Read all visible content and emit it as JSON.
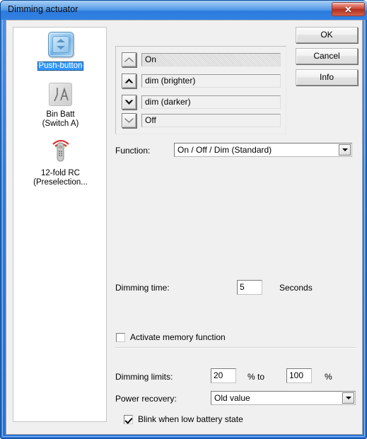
{
  "window": {
    "title": "Dimming actuator",
    "close_label": "✕",
    "accent_color": "#2f7ce0",
    "close_color": "#c33f2d"
  },
  "sidebar": {
    "items": [
      {
        "label": "Push-button",
        "icon": "push-button-icon",
        "selected": true
      },
      {
        "label": "Bin Batt\n(Switch A)",
        "icon": "switch-icon",
        "selected": false
      },
      {
        "label": "12-fold RC\n(Preselection...",
        "icon": "remote-control-icon",
        "selected": false
      }
    ]
  },
  "buttons": {
    "ok": "OK",
    "cancel": "Cancel",
    "info": "Info"
  },
  "rocker_group": {
    "rows": [
      {
        "icon": "chevron-up-thin-icon",
        "value": "On",
        "focused": true
      },
      {
        "icon": "chevron-up-bold-icon",
        "value": "dim (brighter)",
        "focused": false
      },
      {
        "icon": "chevron-down-bold-icon",
        "value": "dim (darker)",
        "focused": false
      },
      {
        "icon": "chevron-down-thin-icon",
        "value": "Off",
        "focused": false
      }
    ]
  },
  "form": {
    "function_label": "Function:",
    "function_value": "On / Off / Dim (Standard)",
    "dimming_time_label": "Dimming time:",
    "dimming_time_value": "5",
    "dimming_time_unit": "Seconds",
    "memory_checkbox_label": "Activate memory function",
    "memory_checkbox_checked": false,
    "dimming_limits_label": "Dimming limits:",
    "dimming_limit_min": "20",
    "dimming_limits_middle_unit": "% to",
    "dimming_limit_max": "100",
    "dimming_limits_end_unit": "%",
    "power_recovery_label": "Power recovery:",
    "power_recovery_value": "Old value",
    "blink_checkbox_label": "Blink when low battery state",
    "blink_checkbox_checked": true
  }
}
